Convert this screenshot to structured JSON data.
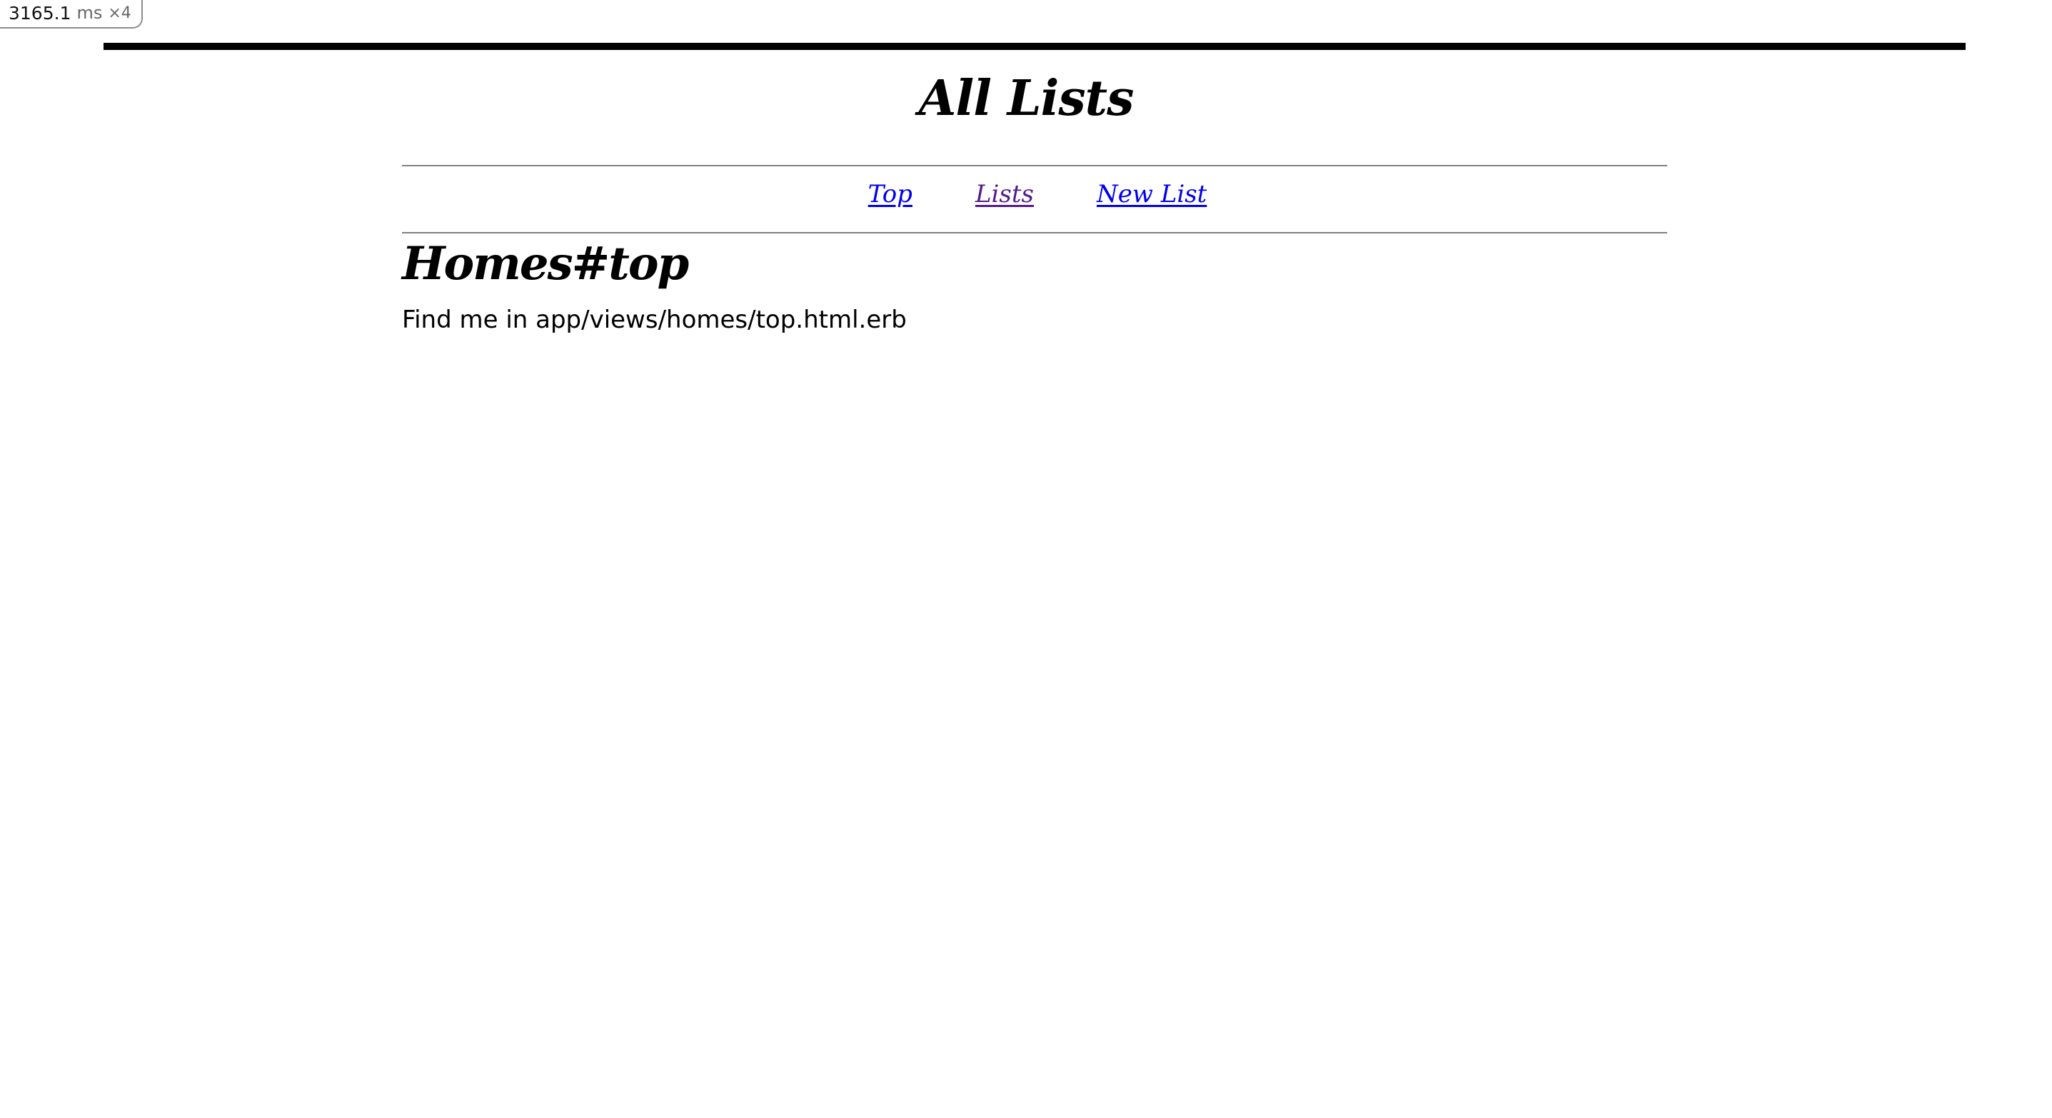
{
  "profiler": {
    "time": "3165.1",
    "unit": "ms",
    "count": "×4"
  },
  "header": {
    "title": "All Lists"
  },
  "nav": {
    "items": [
      {
        "label": "Top",
        "visited": false
      },
      {
        "label": "Lists",
        "visited": true
      },
      {
        "label": "New List",
        "visited": false
      }
    ]
  },
  "main": {
    "heading": "Homes#top",
    "body": "Find me in app/views/homes/top.html.erb"
  },
  "colors": {
    "link": "#0000ee",
    "visited_link": "#551a8b"
  }
}
